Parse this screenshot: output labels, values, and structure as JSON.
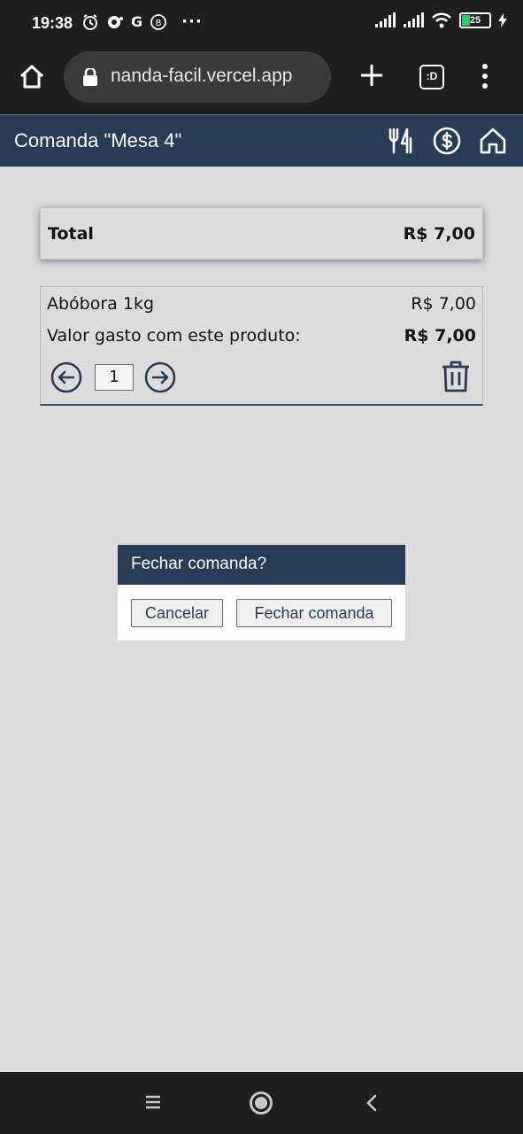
{
  "status_bar": {
    "time": "19:38",
    "battery": "25",
    "icons": [
      "alarm-icon",
      "chat-icon",
      "google-icon",
      "b-icon",
      "more-dots-icon",
      "signal-icon",
      "signal-icon",
      "wifi-icon",
      "battery-icon",
      "charging-icon"
    ],
    "google_letter": "G",
    "b_letter": "B",
    "dots": "···"
  },
  "browser": {
    "url": "nanda-facil.vercel.app",
    "tabs_label": ":D"
  },
  "header": {
    "title": "Comanda \"Mesa 4\"",
    "icons": [
      "utensils-icon",
      "dollar-icon",
      "home-icon"
    ]
  },
  "total": {
    "label": "Total",
    "value": "R$ 7,00"
  },
  "product": {
    "name": "Abóbora 1kg",
    "price": "R$ 7,00",
    "spent_label": "Valor gasto com este produto:",
    "spent_value": "R$ 7,00",
    "quantity": "1"
  },
  "dialog": {
    "title": "Fechar comanda?",
    "cancel_label": "Cancelar",
    "confirm_label": "Fechar comanda"
  },
  "colors": {
    "primary": "#283d55",
    "background": "#dcdcdc",
    "system_bar": "#1f1f1f"
  }
}
